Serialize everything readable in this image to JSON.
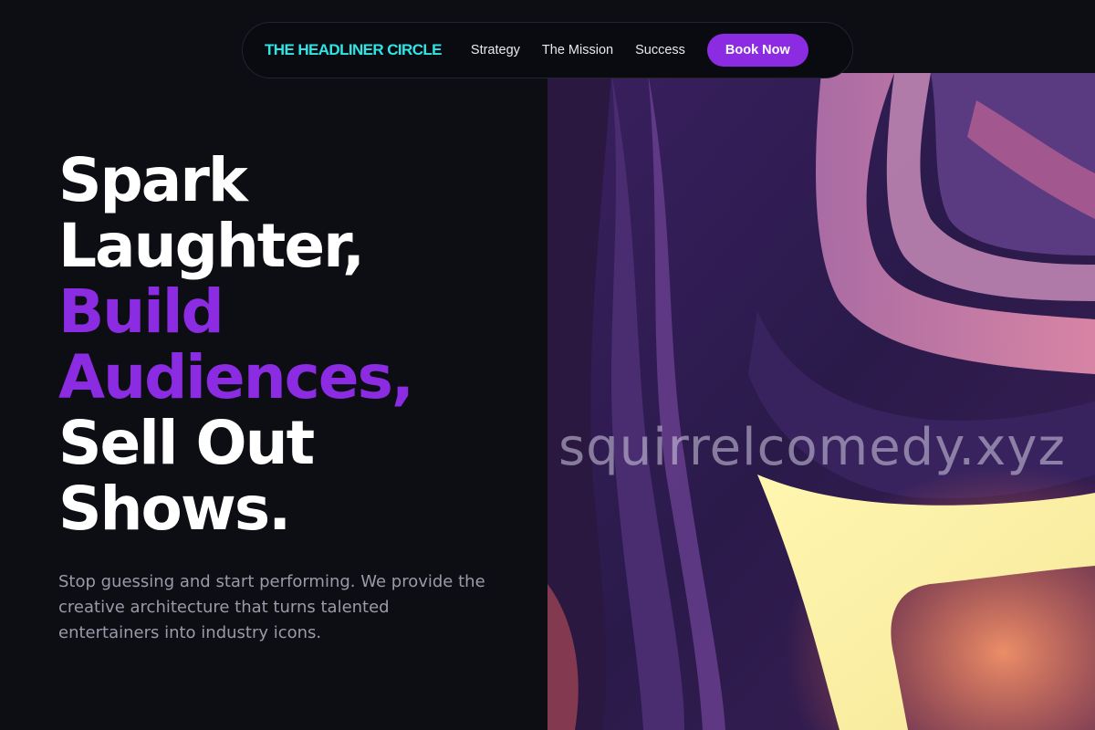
{
  "nav": {
    "brand": "THE HEADLINER CIRCLE",
    "links": [
      {
        "label": "Strategy"
      },
      {
        "label": "The Mission"
      },
      {
        "label": "Success"
      }
    ],
    "cta_label": "Book Now"
  },
  "hero": {
    "headline": {
      "line1": "Spark",
      "line2": "Laughter,",
      "line3": "Build",
      "line4": "Audiences,",
      "line5": "Sell Out",
      "line6": "Shows."
    },
    "subtext": "Stop guessing and start performing. We provide the creative architecture that turns talented entertainers into industry icons.",
    "watermark": "squirrelcomedy.xyz"
  },
  "colors": {
    "background": "#0d0e14",
    "brand": "#2ee6e6",
    "accent": "#8b2be2",
    "headline": "#ffffff",
    "subtext": "#9a9aa8"
  }
}
